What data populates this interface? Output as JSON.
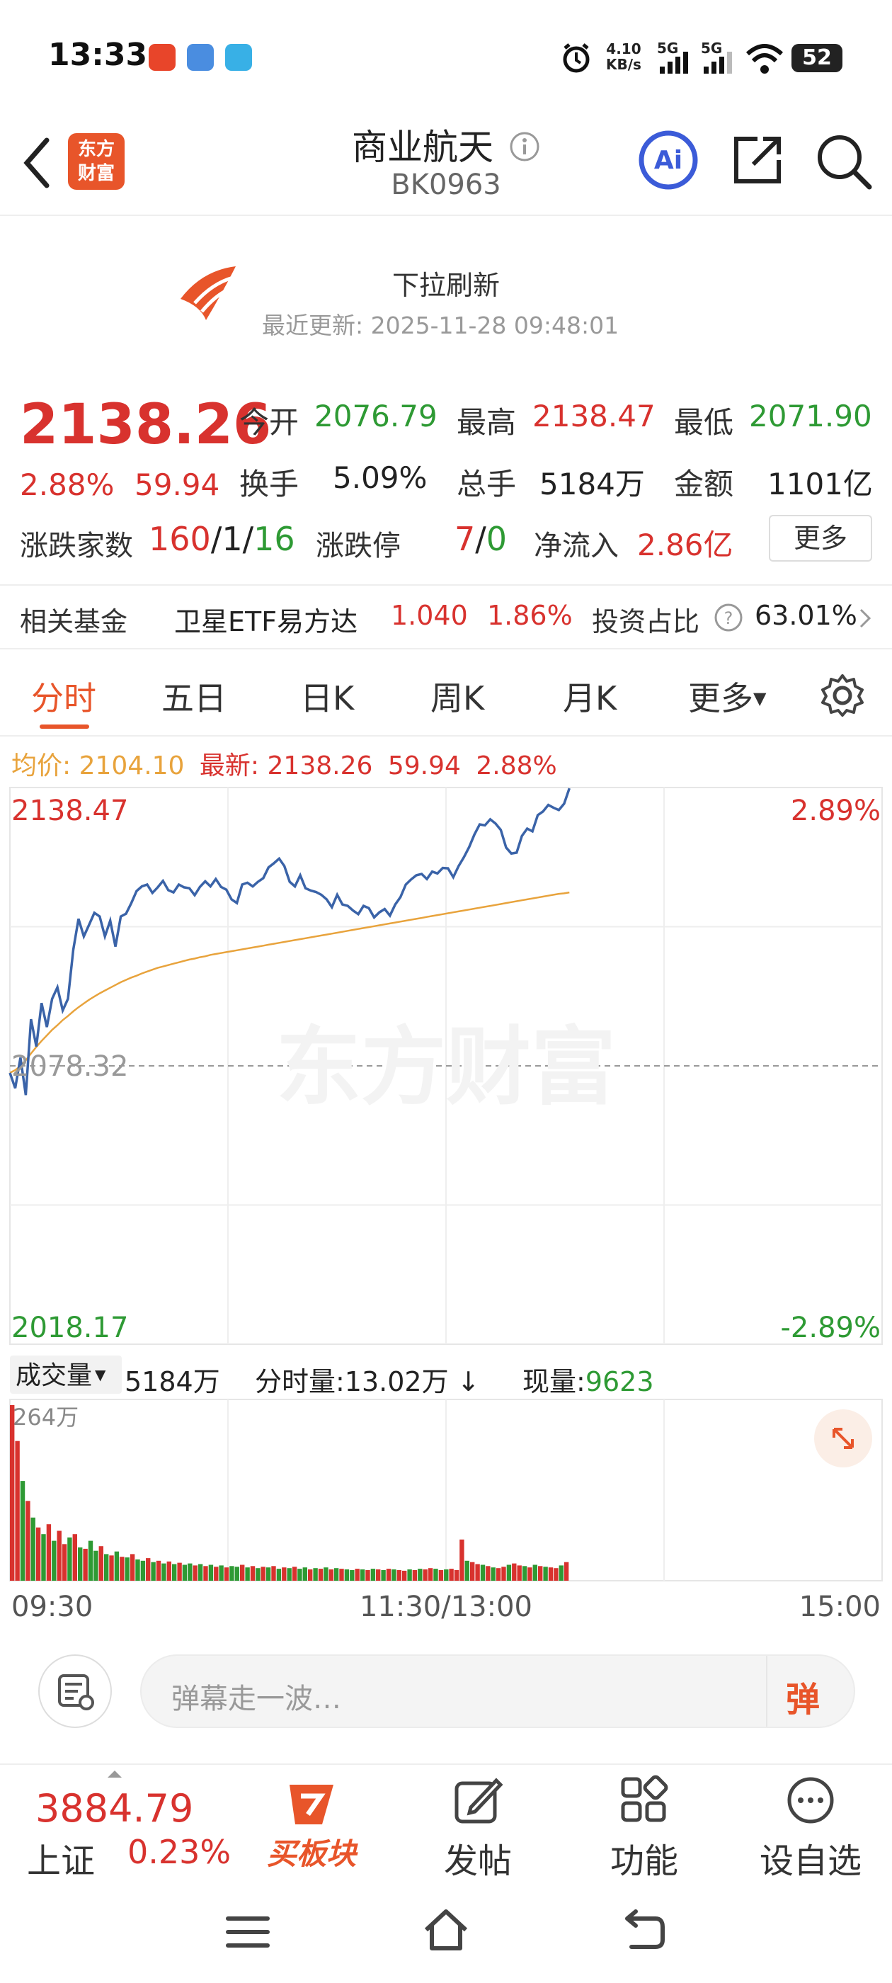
{
  "status_bar": {
    "time": "13:33",
    "net_speed_value": "4.10",
    "net_speed_unit": "KB/s",
    "signal1": "5G",
    "signal2": "5G",
    "battery": "52"
  },
  "header": {
    "logo_line1": "东方",
    "logo_line2": "财富",
    "title": "商业航天",
    "code": "BK0963"
  },
  "refresh": {
    "label": "下拉刷新",
    "updated": "最近更新: 2025-11-28 09:48:01"
  },
  "quote": {
    "price": "2138.26",
    "change_pct": "2.88%",
    "change": "59.94",
    "open_label": "今开",
    "open": "2076.79",
    "high_label": "最高",
    "high": "2138.47",
    "low_label": "最低",
    "low": "2071.90",
    "turnover_label": "换手",
    "turnover": "5.09%",
    "volume_label": "总手",
    "volume": "5184万",
    "amount_label": "金额",
    "amount": "1101亿",
    "breadth_label": "涨跌家数",
    "breadth_up": "160",
    "breadth_sep1": "/",
    "breadth_flat": "1",
    "breadth_sep2": "/",
    "breadth_down": "16",
    "limit_label": "涨跌停",
    "limit_up": "7",
    "limit_sep": "/",
    "limit_down": "0",
    "inflow_label": "净流入",
    "inflow": "2.86亿",
    "more_label": "更多"
  },
  "fund": {
    "label": "相关基金",
    "name": "卫星ETF易方达",
    "price": "1.040",
    "pct": "1.86%",
    "ratio_label": "投资占比",
    "ratio": "63.01%"
  },
  "tabs": [
    "分时",
    "五日",
    "日K",
    "周K",
    "月K",
    "更多"
  ],
  "legend": {
    "avg_label": "均价:",
    "avg": "2104.10",
    "latest_label": "最新:",
    "latest": "2138.26",
    "change": "59.94",
    "pct": "2.88%"
  },
  "volume_panel": {
    "selector": "成交量",
    "total": "5184万",
    "minute_label": "分时量:13.02万",
    "minute_arrow": "↓",
    "current_label": "现量:",
    "current": "9623",
    "max_label": "264万"
  },
  "chart_data": {
    "type": "line",
    "y_top_label": "2138.47",
    "y_mid_label": "2078.32",
    "y_bottom_label": "2018.17",
    "pct_top": "2.89%",
    "pct_bottom": "-2.89%",
    "ylim": [
      2018.17,
      2138.47
    ],
    "prev_close": 2078.32,
    "x_tick_labels": [
      "09:30",
      "11:30/13:00",
      "15:00"
    ],
    "watermark": "东方财富",
    "series": [
      {
        "name": "最新",
        "color": "#3a63a8",
        "values": [
          2076.8,
          2073.5,
          2080.1,
          2072.0,
          2088.4,
          2082.5,
          2091.9,
          2086.7,
          2092.8,
          2095.3,
          2090.3,
          2092.8,
          2103.4,
          2110.1,
          2106.3,
          2108.8,
          2111.4,
          2110.6,
          2106.3,
          2109.7,
          2104.1,
          2110.6,
          2111.2,
          2113.5,
          2116.1,
          2117.1,
          2117.5,
          2115.7,
          2116.9,
          2118.3,
          2116.3,
          2115.8,
          2117.5,
          2116.9,
          2116.7,
          2115.2,
          2117.0,
          2118.2,
          2117.1,
          2118.7,
          2117.0,
          2116.4,
          2114.3,
          2113.5,
          2117.5,
          2117.9,
          2117.1,
          2118.1,
          2118.9,
          2121.2,
          2122.1,
          2123.1,
          2121.5,
          2118.1,
          2117.1,
          2119.5,
          2116.7,
          2116.2,
          2115.9,
          2115.3,
          2114.3,
          2112.6,
          2115.3,
          2113.2,
          2112.9,
          2111.9,
          2111.1,
          2112.9,
          2112.4,
          2110.4,
          2111.5,
          2112.2,
          2110.8,
          2113.2,
          2114.8,
          2117.5,
          2118.6,
          2119.5,
          2119.8,
          2118.7,
          2120.3,
          2119.9,
          2121.1,
          2121.0,
          2119.1,
          2121.5,
          2123.4,
          2125.6,
          2128.3,
          2130.5,
          2130.3,
          2131.6,
          2130.7,
          2129.3,
          2125.5,
          2124.2,
          2124.4,
          2128.0,
          2129.6,
          2129.0,
          2132.5,
          2133.3,
          2134.7,
          2134.1,
          2133.6,
          2135.0,
          2138.3
        ]
      },
      {
        "name": "均价",
        "color": "#e8a33c",
        "values": [
          2076.8,
          2077.4,
          2078.3,
          2079.5,
          2081.0,
          2082.4,
          2083.7,
          2084.9,
          2086.1,
          2087.1,
          2088.2,
          2089.1,
          2090.1,
          2091.0,
          2091.8,
          2092.6,
          2093.3,
          2094.0,
          2094.6,
          2095.2,
          2095.8,
          2096.4,
          2096.9,
          2097.4,
          2097.8,
          2098.3,
          2098.7,
          2099.1,
          2099.5,
          2099.8,
          2100.1,
          2100.4,
          2100.7,
          2101.0,
          2101.3,
          2101.5,
          2101.8,
          2102.0,
          2102.3,
          2102.5,
          2102.7,
          2102.9,
          2103.1,
          2103.3,
          2103.5,
          2103.7,
          2103.9,
          2104.1,
          2104.3,
          2104.5,
          2104.7,
          2104.9,
          2105.1,
          2105.3,
          2105.5,
          2105.7,
          2105.9,
          2106.1,
          2106.3,
          2106.5,
          2106.7,
          2106.9,
          2107.1,
          2107.3,
          2107.5,
          2107.7,
          2107.9,
          2108.1,
          2108.3,
          2108.5,
          2108.7,
          2108.9,
          2109.1,
          2109.3,
          2109.5,
          2109.7,
          2109.9,
          2110.1,
          2110.3,
          2110.5,
          2110.7,
          2110.9,
          2111.1,
          2111.3,
          2111.5,
          2111.7,
          2111.9,
          2112.1,
          2112.3,
          2112.5,
          2112.7,
          2112.9,
          2113.1,
          2113.3,
          2113.5,
          2113.7,
          2113.9,
          2114.1,
          2114.3,
          2114.5,
          2114.7,
          2114.9,
          2115.1,
          2115.3,
          2115.5,
          2115.6,
          2115.8
        ]
      }
    ],
    "volume": {
      "max": 264,
      "unit": "万",
      "values": [
        264,
        210,
        150,
        120,
        95,
        80,
        70,
        85,
        60,
        75,
        55,
        65,
        70,
        50,
        48,
        60,
        45,
        52,
        40,
        38,
        44,
        36,
        35,
        40,
        32,
        30,
        34,
        28,
        30,
        26,
        29,
        25,
        27,
        24,
        26,
        23,
        25,
        22,
        24,
        21,
        23,
        20,
        22,
        21,
        24,
        20,
        22,
        19,
        21,
        20,
        22,
        18,
        20,
        19,
        21,
        18,
        20,
        17,
        19,
        18,
        20,
        17,
        19,
        18,
        17,
        16,
        18,
        17,
        16,
        18,
        17,
        16,
        18,
        17,
        16,
        15,
        17,
        16,
        18,
        17,
        19,
        18,
        16,
        17,
        18,
        16,
        62,
        30,
        28,
        25,
        24,
        22,
        20,
        19,
        21,
        24,
        26,
        23,
        22,
        20,
        24,
        22,
        21,
        20,
        19,
        23,
        28
      ],
      "colors": [
        "r",
        "r",
        "g",
        "r",
        "g",
        "r",
        "g",
        "r",
        "g",
        "r",
        "r",
        "g",
        "r",
        "g",
        "r",
        "g",
        "g",
        "r",
        "g",
        "r",
        "g",
        "r",
        "g",
        "r",
        "g",
        "g",
        "r",
        "g",
        "r",
        "g",
        "r",
        "g",
        "r",
        "g",
        "g",
        "r",
        "g",
        "r",
        "g",
        "r",
        "g",
        "r",
        "g",
        "g",
        "r",
        "g",
        "r",
        "g",
        "r",
        "g",
        "r",
        "g",
        "r",
        "g",
        "r",
        "g",
        "g",
        "r",
        "g",
        "r",
        "g",
        "r",
        "g",
        "r",
        "g",
        "g",
        "r",
        "g",
        "r",
        "g",
        "r",
        "g",
        "r",
        "g",
        "r",
        "r",
        "g",
        "r",
        "g",
        "r",
        "r",
        "g",
        "r",
        "g",
        "r",
        "r",
        "r",
        "g",
        "r",
        "r",
        "g",
        "r",
        "g",
        "r",
        "r",
        "g",
        "r",
        "r",
        "g",
        "r",
        "g",
        "r",
        "g",
        "r",
        "r",
        "g",
        "r"
      ]
    }
  },
  "danmu": {
    "placeholder": "弹幕走一波…",
    "button": "弹"
  },
  "bottom": {
    "index_value": "3884.79",
    "index_name": "上证",
    "index_pct": "0.23%",
    "buy_label": "买板块",
    "post_label": "发帖",
    "func_label": "功能",
    "watch_label": "设自选"
  },
  "colors": {
    "up": "#d8322e",
    "down": "#2e9a34",
    "accent": "#e8552a",
    "price_line": "#3a63a8",
    "avg_line": "#e8a33c"
  }
}
